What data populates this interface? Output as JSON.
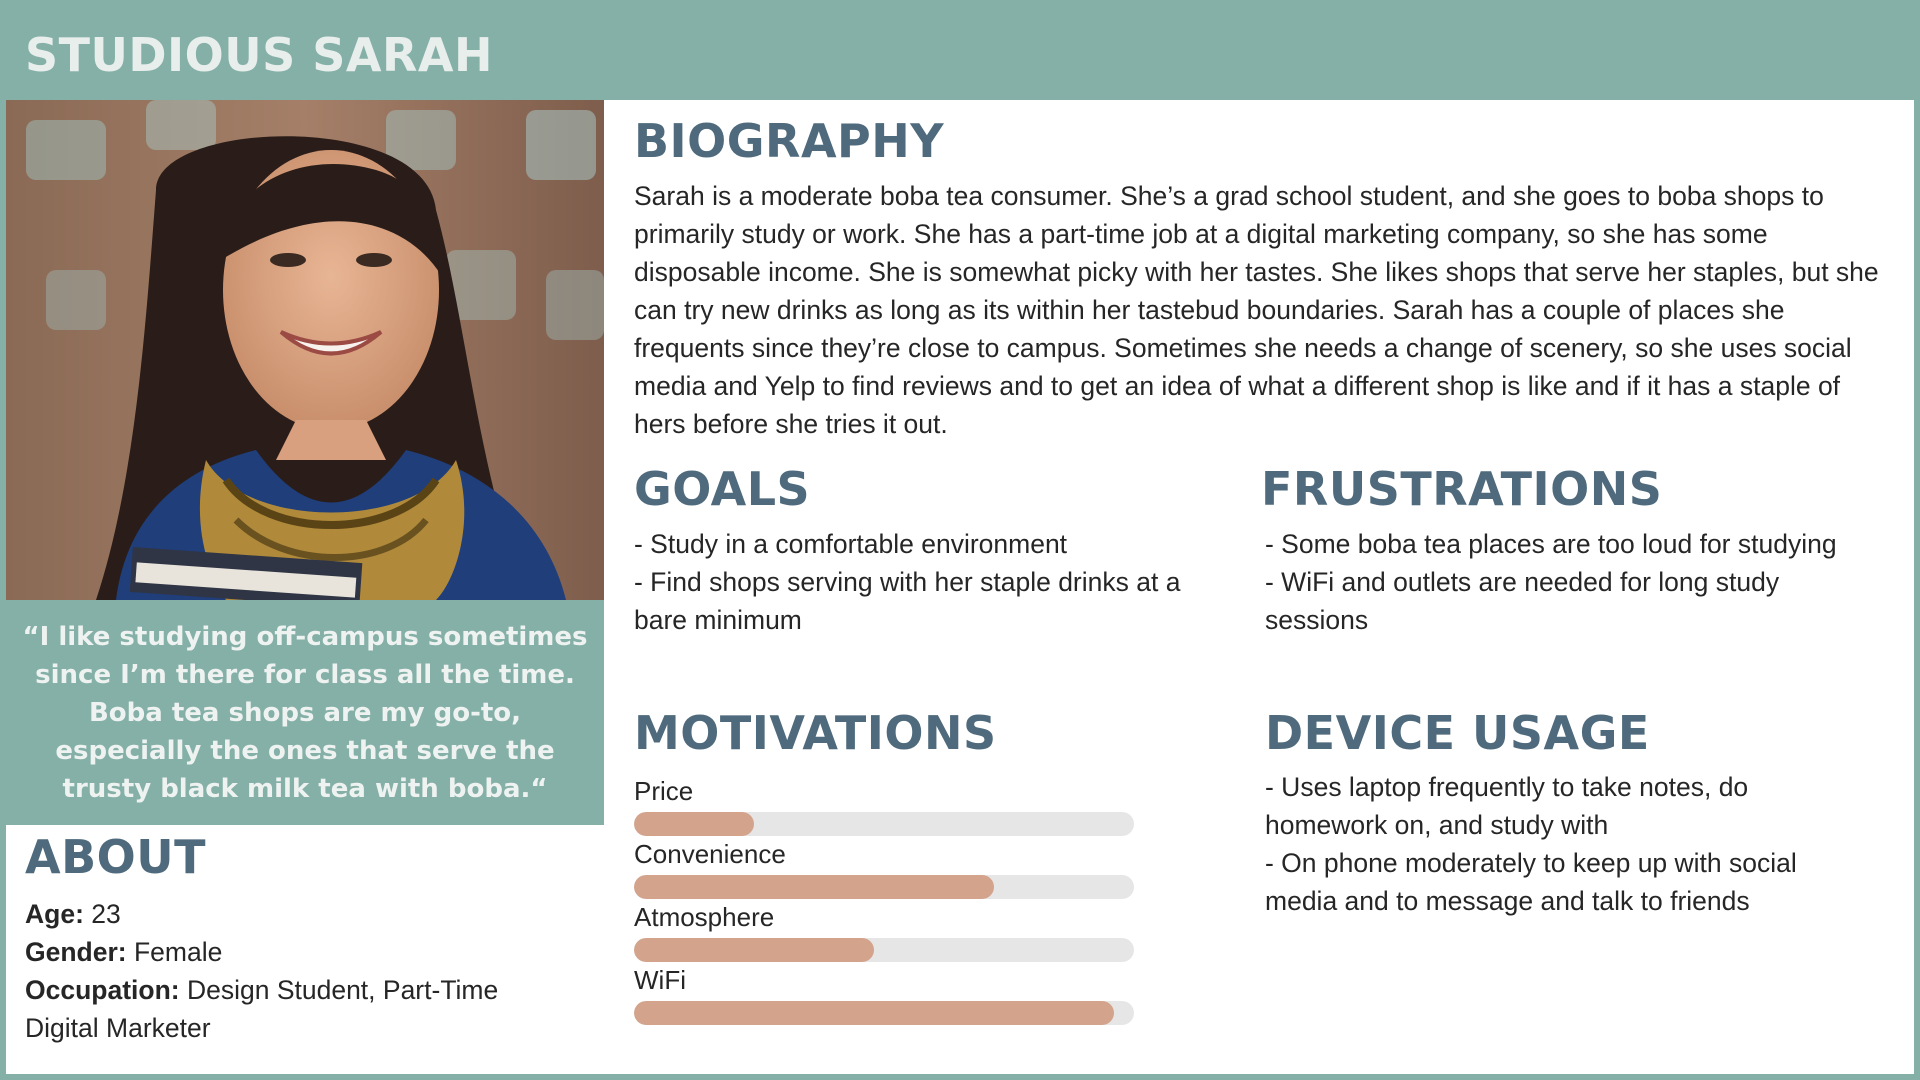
{
  "persona": {
    "name": "STUDIOUS SARAH",
    "quote": "“I like studying off-campus sometimes since I’m there for class all the time. Boba tea shops are my go-to, especially the ones that serve the trusty black milk tea with boba.“"
  },
  "about": {
    "heading": "ABOUT",
    "age_label": "Age:",
    "age_value": "23",
    "gender_label": "Gender:",
    "gender_value": "Female",
    "occupation_label": "Occupation:",
    "occupation_value": "Design Student, Part-Time Digital Marketer"
  },
  "biography": {
    "heading": "BIOGRAPHY",
    "text": "Sarah is a moderate boba tea consumer. She’s a grad school student, and she goes to boba shops to primarily study or work. She has a part-time job at a digital marketing company, so she has some disposable income. She is somewhat picky with her tastes. She likes shops that serve her staples, but she can try new drinks as long as its within her tastebud boundaries. Sarah has a couple of places she frequents since they’re close to campus. Sometimes she needs a change of scenery, so she uses social media and Yelp to find reviews and to get an idea of what a different shop is like and if it has a staple of hers before she tries it out."
  },
  "goals": {
    "heading": "GOALS",
    "items": [
      "- Study in a comfortable environment",
      "- Find shops serving with her staple drinks at a bare minimum"
    ]
  },
  "frustrations": {
    "heading": "FRUSTRATIONS",
    "items": [
      "- Some boba tea places are too loud for studying",
      "- WiFi and outlets are needed for long study sessions"
    ]
  },
  "motivations": {
    "heading": "MOTIVATIONS",
    "items": [
      {
        "label": "Price",
        "level": 0.24
      },
      {
        "label": "Convenience",
        "level": 0.72
      },
      {
        "label": "Atmosphere",
        "level": 0.48
      },
      {
        "label": "WiFi",
        "level": 0.96
      }
    ]
  },
  "device_usage": {
    "heading": "DEVICE USAGE",
    "items": [
      "- Uses laptop frequently to take notes, do homework on, and study with",
      "- On phone moderately to keep up with social media and to message and talk to friends"
    ]
  },
  "colors": {
    "background": "#85b0a7",
    "heading": "#4e6a7c",
    "bar_fill": "#d4a38b",
    "bar_track": "#e6e6e6"
  }
}
